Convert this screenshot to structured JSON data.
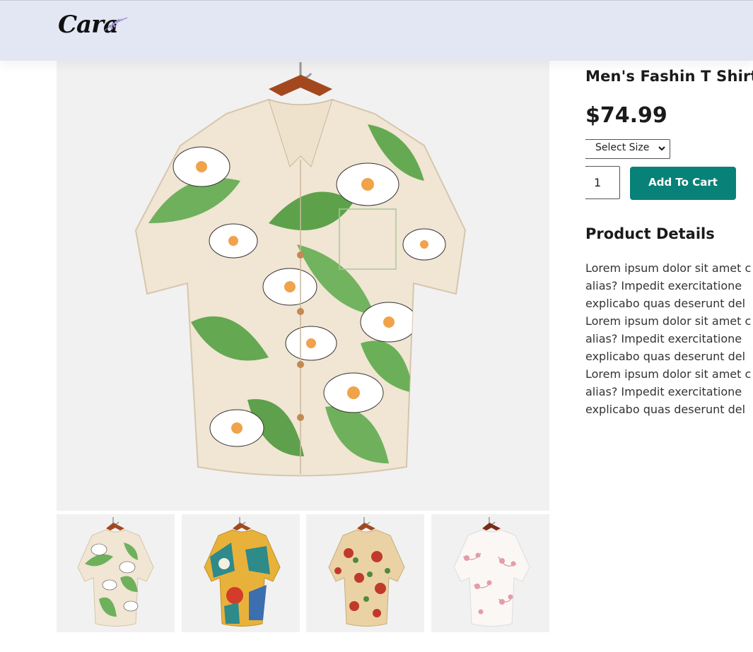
{
  "brand": {
    "logo_text": "Cara",
    "logo_icon": "lavender-sprig-icon"
  },
  "product": {
    "title": "Men's Fashin T Shirt",
    "price": "$74.99",
    "size_select": {
      "selected": "Select Size"
    },
    "quantity": "1",
    "add_to_cart_label": "Add To Cart"
  },
  "details": {
    "heading": "Product Details",
    "lines": [
      "Lorem ipsum dolor sit amet c",
      "alias? Impedit exercitatione",
      "explicabo quas deserunt del",
      "Lorem ipsum dolor sit amet c",
      "alias? Impedit exercitatione",
      "explicabo quas deserunt del",
      "Lorem ipsum dolor sit amet c",
      "alias? Impedit exercitatione",
      "explicabo quas deserunt del"
    ]
  },
  "images": {
    "main": "floral-shirt-cream-green",
    "thumbnails": [
      "floral-shirt-cream-green",
      "abstract-shirt-yellow-teal",
      "floral-shirt-red-beige",
      "floral-shirt-white-pink"
    ]
  },
  "colors": {
    "header_bg": "#e3e6f3",
    "accent": "#088178",
    "image_bg": "#f1f1f1"
  }
}
